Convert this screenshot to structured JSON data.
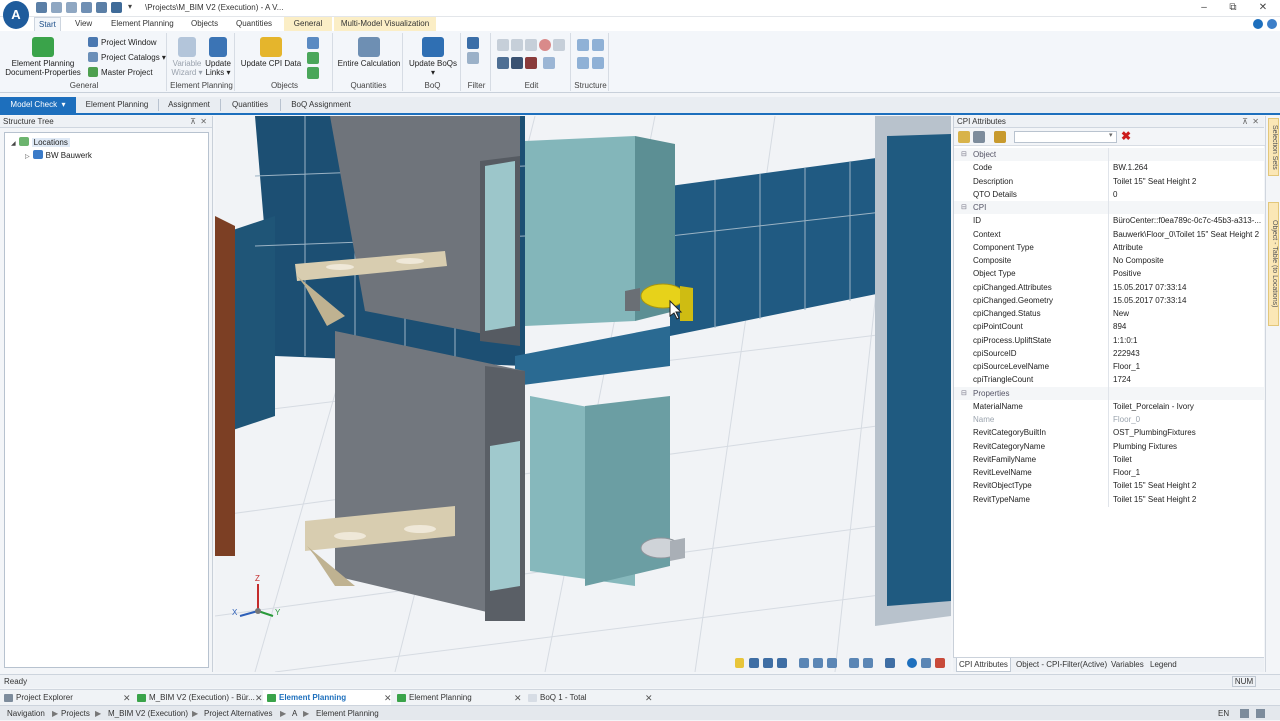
{
  "app": {
    "logo": "A",
    "window_title": "\\Projects\\M_BIM V2 (Execution) - A V...",
    "window_buttons": [
      "–",
      "⧉",
      "✕"
    ]
  },
  "ribbon_tabs": [
    "Start",
    "View",
    "Element Planning",
    "Objects",
    "Quantities",
    "General",
    "Multi-Model Visualization"
  ],
  "ribbon": {
    "general": {
      "big_button_line1": "Element Planning",
      "big_button_line2": "Document-Properties",
      "project_window": "Project Window",
      "project_catalogs": "Project Catalogs",
      "master_project": "Master Project",
      "label": "General"
    },
    "element_planning": {
      "variable_wizard_1": "Variable",
      "variable_wizard_2": "Wizard",
      "update_links_1": "Update",
      "update_links_2": "Links",
      "label": "Element Planning"
    },
    "objects": {
      "update_cpi": "Update CPI Data",
      "label": "Objects"
    },
    "quantities": {
      "entire_calc": "Entire Calculation",
      "label": "Quantities"
    },
    "boq": {
      "update_boqs": "Update BoQs",
      "label": "BoQ"
    },
    "filter": {
      "label": "Filter"
    },
    "edit": {
      "label": "Edit"
    },
    "structure": {
      "label": "Structure"
    }
  },
  "workflow_steps": [
    "Model Check",
    "Element Planning",
    "Assignment",
    "Quantities",
    "BoQ Assignment"
  ],
  "structure_tree": {
    "title": "Structure Tree",
    "pin": "⊼",
    "close": "✕",
    "items": [
      {
        "label": "Locations",
        "toggle": "◢"
      },
      {
        "label": "BW Bauwerk",
        "toggle": "▷"
      }
    ]
  },
  "viewport": {
    "axis_z": "Z",
    "axis_y": "Y",
    "axis_x": "X"
  },
  "cpi": {
    "title": "CPI Attributes",
    "search_value": "",
    "sections": [
      {
        "name": "Object",
        "rows": [
          {
            "k": "Code",
            "v": "BW.1.264"
          },
          {
            "k": "Description",
            "v": "Toilet 15\" Seat Height 2"
          },
          {
            "k": "QTO Details",
            "v": "0"
          }
        ]
      },
      {
        "name": "CPI",
        "rows": [
          {
            "k": "ID",
            "v": "BüroCenter::f0ea789c-0c7c-45b3-a313-..."
          },
          {
            "k": "Context",
            "v": "Bauwerk\\Floor_0\\Toilet 15\" Seat Height 2"
          },
          {
            "k": "Component Type",
            "v": "Attribute"
          },
          {
            "k": "Composite",
            "v": "No Composite"
          },
          {
            "k": "Object Type",
            "v": "Positive"
          },
          {
            "k": "cpiChanged.Attributes",
            "v": "15.05.2017 07:33:14"
          },
          {
            "k": "cpiChanged.Geometry",
            "v": "15.05.2017 07:33:14"
          },
          {
            "k": "cpiChanged.Status",
            "v": "New"
          },
          {
            "k": "cpiPointCount",
            "v": "894"
          },
          {
            "k": "cpiProcess.UpliftState",
            "v": "1:1:0:1"
          },
          {
            "k": "cpiSourceID",
            "v": "222943"
          },
          {
            "k": "cpiSourceLevelName",
            "v": "Floor_1"
          },
          {
            "k": "cpiTriangleCount",
            "v": "1724"
          }
        ]
      },
      {
        "name": "Properties",
        "rows": [
          {
            "k": "MaterialName",
            "v": "Toilet_Porcelain - Ivory"
          },
          {
            "k": "Name",
            "v": "Floor_0",
            "grey": true
          },
          {
            "k": "RevitCategoryBuiltIn",
            "v": "OST_PlumbingFixtures"
          },
          {
            "k": "RevitCategoryName",
            "v": "Plumbing Fixtures"
          },
          {
            "k": "RevitFamilyName",
            "v": "Toilet"
          },
          {
            "k": "RevitLevelName",
            "v": "Floor_1"
          },
          {
            "k": "RevitObjectType",
            "v": "Toilet 15\" Seat Height 2"
          },
          {
            "k": "RevitTypeName",
            "v": "Toilet 15\" Seat Height 2"
          }
        ]
      }
    ],
    "bottom_tabs": [
      "CPI Attributes",
      "Object - CPI-Filter(Active)",
      "Variables",
      "Legend"
    ]
  },
  "side_tabs": [
    "Selection Sets",
    "Object - Table (to Locations)"
  ],
  "status": {
    "left": "Ready",
    "num": "NUM"
  },
  "doc_tabs": [
    {
      "label": "Project Explorer",
      "close": "✕"
    },
    {
      "label": "M_BIM V2 (Execution) - Bür...",
      "close": "✕"
    },
    {
      "label": "Element Planning",
      "close": "✕",
      "active": true
    },
    {
      "label": "Element Planning",
      "close": "✕"
    },
    {
      "label": "BoQ 1 - Total",
      "close": "✕"
    }
  ],
  "navigation": {
    "label": "Navigation",
    "crumbs": [
      "Projects",
      "M_BIM V2 (Execution)",
      "Project Alternatives",
      "A",
      "Element Planning"
    ],
    "lang": "EN"
  },
  "colors": {
    "accent": "#1d6fbd",
    "glass": "#1c4f73",
    "stall": "#7fb1b5",
    "selected_toilet": "#e7d21a",
    "delete_red": "#cc1c1c"
  }
}
